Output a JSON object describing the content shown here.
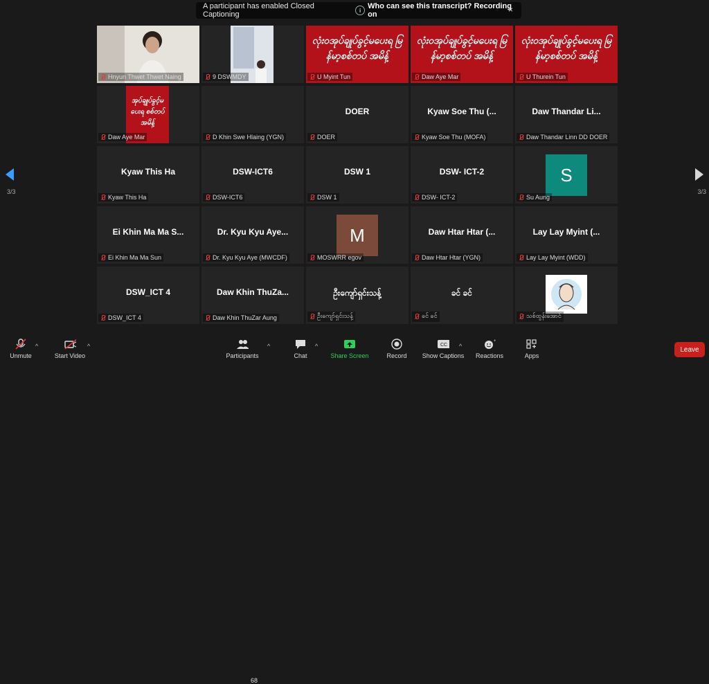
{
  "banner": {
    "message": "A participant has enabled Closed Captioning",
    "pill": "Who can see this transcript? Recording on",
    "close": "×"
  },
  "page_indicator": {
    "left": "3/3",
    "right": "3/3"
  },
  "tiles": [
    {
      "name": "Hnyun Thwet Thwet Naing",
      "big": ""
    },
    {
      "name": "9 DSWMDY",
      "big": ""
    },
    {
      "name": "U Myint Tun",
      "big": "",
      "mm": "လုံးဝအုပ်ချုပ်ခွင့်မပေးရ မြန်မာ့စစ်တပ် အမိန့်"
    },
    {
      "name": "Daw Aye Mar",
      "big": "",
      "mm": "လုံးဝအုပ်ချုပ်ခွင့်မပေးရ မြန်မာ့စစ်တပ် အမိန့်"
    },
    {
      "name": "U Thurein Tun",
      "big": "",
      "mm": "လုံးဝအုပ်ချုပ်ခွင့်မပေးရ မြန်မာ့စစ်တပ် အမိန့်"
    },
    {
      "name": "Daw Aye Mar",
      "big": "",
      "mm": "အုပ်ချုပ်ခွင့်မပေးရ စစ်တပ် အမိန့်"
    },
    {
      "name": "D Khin Swe Hlaing (YGN)",
      "big": ""
    },
    {
      "name": "DOER",
      "big": "DOER"
    },
    {
      "name": "Kyaw Soe Thu (MOFA)",
      "big": "Kyaw Soe Thu (..."
    },
    {
      "name": "Daw Thandar Linn DD DOER",
      "big": "Daw Thandar Li..."
    },
    {
      "name": "Kyaw This Ha",
      "big": "Kyaw This Ha"
    },
    {
      "name": "DSW-ICT6",
      "big": "DSW-ICT6"
    },
    {
      "name": "DSW 1",
      "big": "DSW 1"
    },
    {
      "name": "DSW- ICT-2",
      "big": "DSW- ICT-2"
    },
    {
      "name": "Su Aung",
      "big": "",
      "avatar": "S"
    },
    {
      "name": "Ei Khin Ma Ma Sun",
      "big": "Ei Khin Ma Ma S..."
    },
    {
      "name": "Dr. Kyu Kyu Aye (MWCDF)",
      "big": "Dr. Kyu Kyu Aye..."
    },
    {
      "name": "MOSWRR egov",
      "big": "",
      "avatar": "M"
    },
    {
      "name": "Daw Htar Htar (YGN)",
      "big": "Daw Htar Htar (..."
    },
    {
      "name": "Lay Lay Myint (WDD)",
      "big": "Lay Lay Myint (..."
    },
    {
      "name": "DSW_ICT 4",
      "big": "DSW_ICT 4"
    },
    {
      "name": "Daw Khin ThuZar Aung",
      "big": "Daw Khin ThuZa..."
    },
    {
      "name": "ဦးကျော်ရှင်းသန့်",
      "big": "ဦးကျော်ရှင်းသန့်"
    },
    {
      "name": "ခင် ခင်",
      "big": "ခင် ခင်"
    },
    {
      "name": "သစ်ထွန်းအောင်",
      "big": ""
    }
  ],
  "toolbar": {
    "unmute": "Unmute",
    "start_video": "Start Video",
    "participants": "Participants",
    "participants_count": "68",
    "chat": "Chat",
    "share_screen": "Share Screen",
    "record": "Record",
    "show_captions": "Show Captions",
    "reactions": "Reactions",
    "apps": "Apps",
    "leave": "Leave"
  },
  "colors": {
    "accent_blue": "#3b9cff",
    "share_green": "#2fd05a",
    "leave_red": "#c8211d",
    "tile_red": "#b3121b"
  }
}
